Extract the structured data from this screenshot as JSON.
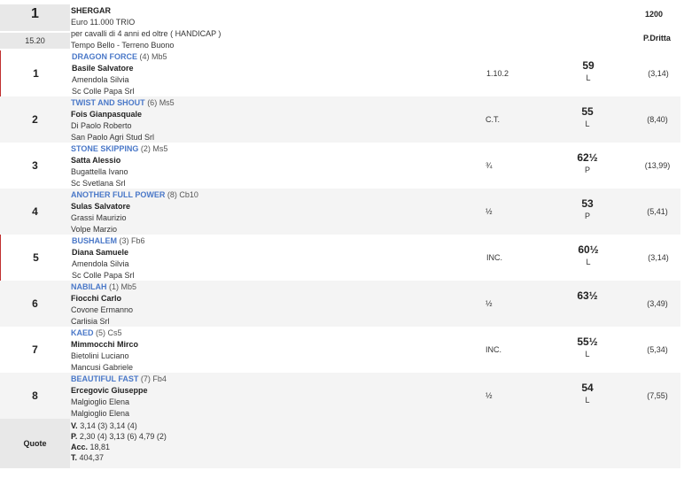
{
  "race": {
    "number": "1",
    "time": "15.20",
    "name": "SHERGAR",
    "purse": "Euro 11.000 TRIO",
    "conditions": "per cavalli di 4 anni ed oltre ( HANDICAP )",
    "weather": "Tempo Bello - Terreno Buono",
    "distance": "1200",
    "track": "P.Dritta"
  },
  "runners": [
    {
      "pos": "1",
      "horse": "DRAGON FORCE",
      "extra": "(4) Mb5",
      "jockey": "Basile Salvatore",
      "trainer": "Amendola Silvia",
      "owner": "Sc Colle Papa Srl",
      "margin": "1.10.2",
      "weight": "59",
      "letter": "L",
      "odds": "(3,14)"
    },
    {
      "pos": "2",
      "horse": "TWIST AND SHOUT",
      "extra": "(6) Ms5",
      "jockey": "Fois Gianpasquale",
      "trainer": "Di Paolo Roberto",
      "owner": "San Paolo Agri Stud Srl",
      "margin": "C.T.",
      "weight": "55",
      "letter": "L",
      "odds": "(8,40)"
    },
    {
      "pos": "3",
      "horse": "STONE SKIPPING",
      "extra": "(2) Ms5",
      "jockey": "Satta Alessio",
      "trainer": "Bugattella Ivano",
      "owner": "Sc Svetlana Srl",
      "margin": "¾",
      "weight": "62½",
      "letter": "P",
      "odds": "(13,99)"
    },
    {
      "pos": "4",
      "horse": "ANOTHER FULL POWER",
      "extra": "(8) Cb10",
      "jockey": "Sulas Salvatore",
      "trainer": "Grassi Maurizio",
      "owner": "Volpe Marzio",
      "margin": "½",
      "weight": "53",
      "letter": "P",
      "odds": "(5,41)"
    },
    {
      "pos": "5",
      "horse": "BUSHALEM",
      "extra": "(3) Fb6",
      "jockey": "Diana Samuele",
      "trainer": "Amendola Silvia",
      "owner": "Sc Colle Papa Srl",
      "margin": "INC.",
      "weight": "60½",
      "letter": "L",
      "odds": "(3,14)"
    },
    {
      "pos": "6",
      "horse": "NABILAH",
      "extra": "(1) Mb5",
      "jockey": "Fiocchi Carlo",
      "trainer": "Covone Ermanno",
      "owner": "Carlisia Srl",
      "margin": "½",
      "weight": "63½",
      "letter": "",
      "odds": "(3,49)"
    },
    {
      "pos": "7",
      "horse": "KAED",
      "extra": "(5) Cs5",
      "jockey": "Mimmocchi Mirco",
      "trainer": "Bietolini Luciano",
      "owner": "Mancusi Gabriele",
      "margin": "INC.",
      "weight": "55½",
      "letter": "L",
      "odds": "(5,34)"
    },
    {
      "pos": "8",
      "horse": "BEAUTIFUL FAST",
      "extra": "(7) Fb4",
      "jockey": "Ercegovic Giuseppe",
      "trainer": "Malgioglio Elena",
      "owner": "Malgioglio Elena",
      "margin": "½",
      "weight": "54",
      "letter": "L",
      "odds": "(7,55)"
    }
  ],
  "quote": {
    "label": "Quote",
    "v_label": "V.",
    "v_value": "3,14 (3)  3,14 (4)",
    "p_label": "P.",
    "p_value": "2,30 (4)  3,13 (6)  4,79 (2)",
    "acc_label": "Acc.",
    "acc_value": "18,81",
    "t_label": "T.",
    "t_value": "404,37"
  }
}
